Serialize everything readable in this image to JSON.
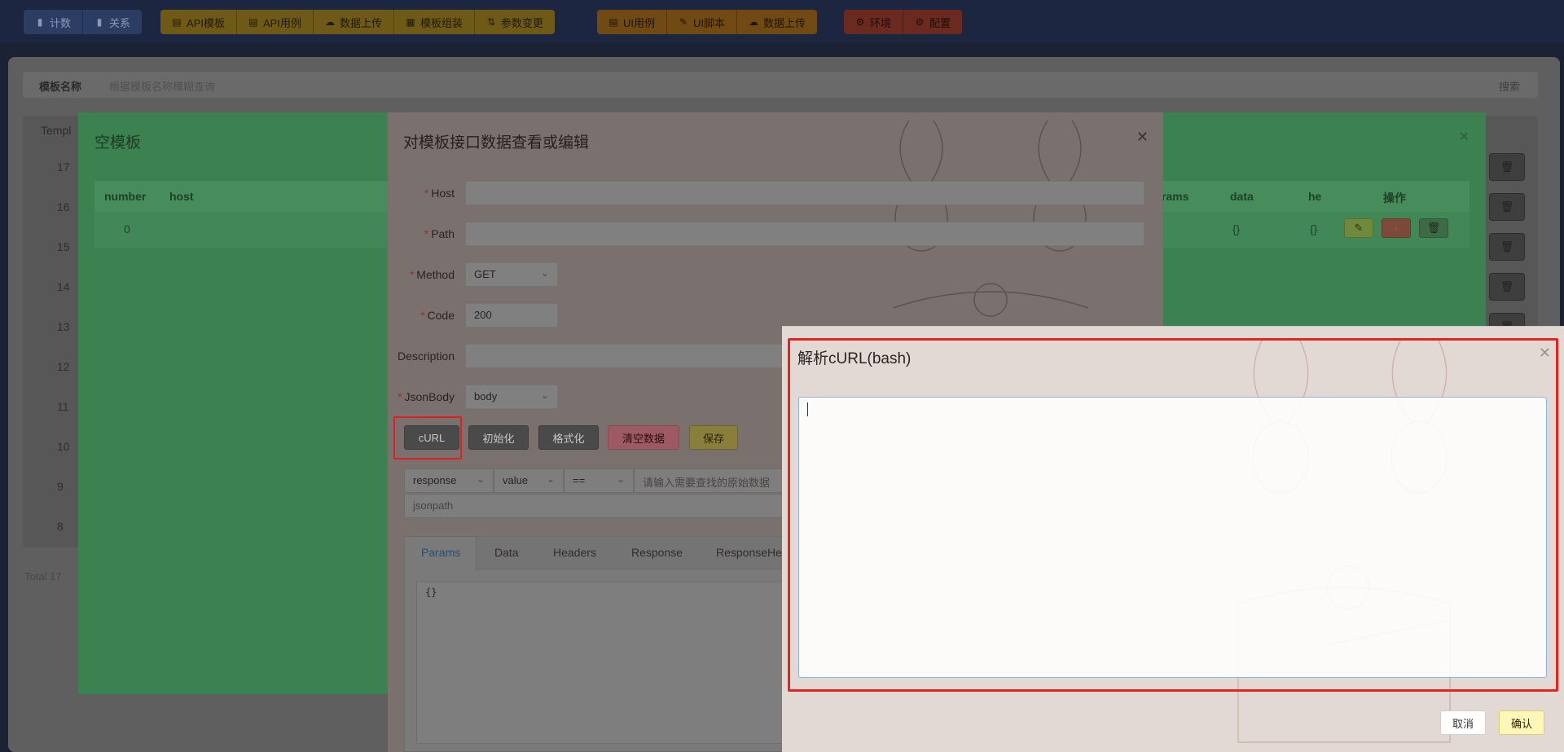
{
  "toolbar": {
    "groups": [
      {
        "style": "blue",
        "items": [
          {
            "label": "计数",
            "icon": "bar-chart-icon"
          },
          {
            "label": "关系",
            "icon": "bar-chart-icon"
          }
        ]
      },
      {
        "style": "yellow",
        "items": [
          {
            "label": "API模板",
            "icon": "clipboard-icon"
          },
          {
            "label": "API用例",
            "icon": "clipboard-icon"
          },
          {
            "label": "数据上传",
            "icon": "cloud-upload-icon"
          },
          {
            "label": "模板组装",
            "icon": "grid-icon"
          },
          {
            "label": "参数变更",
            "icon": "swap-icon"
          }
        ]
      },
      {
        "style": "orange",
        "items": [
          {
            "label": "UI用例",
            "icon": "clipboard-icon"
          },
          {
            "label": "UI脚本",
            "icon": "edit-icon"
          },
          {
            "label": "数据上传",
            "icon": "cloud-upload-icon"
          }
        ]
      },
      {
        "style": "red",
        "items": [
          {
            "label": "环境",
            "icon": "gear-icon"
          },
          {
            "label": "配置",
            "icon": "gear-icon"
          }
        ]
      }
    ]
  },
  "base_page": {
    "search_label": "模板名称",
    "search_placeholder": "根据模板名称模糊查询",
    "search_button": "搜索",
    "column_header": "Templ",
    "row_numbers": [
      "17",
      "16",
      "15",
      "14",
      "13",
      "12",
      "11",
      "10",
      "9",
      "8"
    ],
    "total_text": "Total 17"
  },
  "green_modal": {
    "title": "空模板",
    "columns": [
      "number",
      "host",
      "rams",
      "data",
      "he",
      "操作"
    ],
    "row": {
      "number": "0",
      "data": "{}",
      "headers": "{}"
    }
  },
  "edit_modal": {
    "title": "对模板接口数据查看或编辑",
    "fields": {
      "host": {
        "label": "Host",
        "value": ""
      },
      "path": {
        "label": "Path",
        "value": ""
      },
      "method": {
        "label": "Method",
        "value": "GET"
      },
      "code": {
        "label": "Code",
        "value": "200"
      },
      "description": {
        "label": "Description",
        "value": ""
      },
      "jsonbody": {
        "label": "JsonBody",
        "value": "body"
      }
    },
    "buttons": {
      "curl": "cURL",
      "init": "初始化",
      "format": "格式化",
      "clear": "清空数据",
      "save": "保存"
    },
    "filter": {
      "source": "response",
      "kind": "value",
      "op": "==",
      "placeholder": "请输入需要查找的原始数据"
    },
    "jsonpath_placeholder": "jsonpath",
    "tabs": [
      "Params",
      "Data",
      "Headers",
      "Response",
      "ResponseHe"
    ],
    "code_content": "{}"
  },
  "curl_dialog": {
    "title": "解析cURL(bash)",
    "textarea_value": "",
    "cancel": "取消",
    "confirm": "确认"
  },
  "colors": {
    "accent_red": "#e0261f",
    "confirm_bg": "#fff6b8",
    "textarea_border": "#8fb3e0"
  }
}
